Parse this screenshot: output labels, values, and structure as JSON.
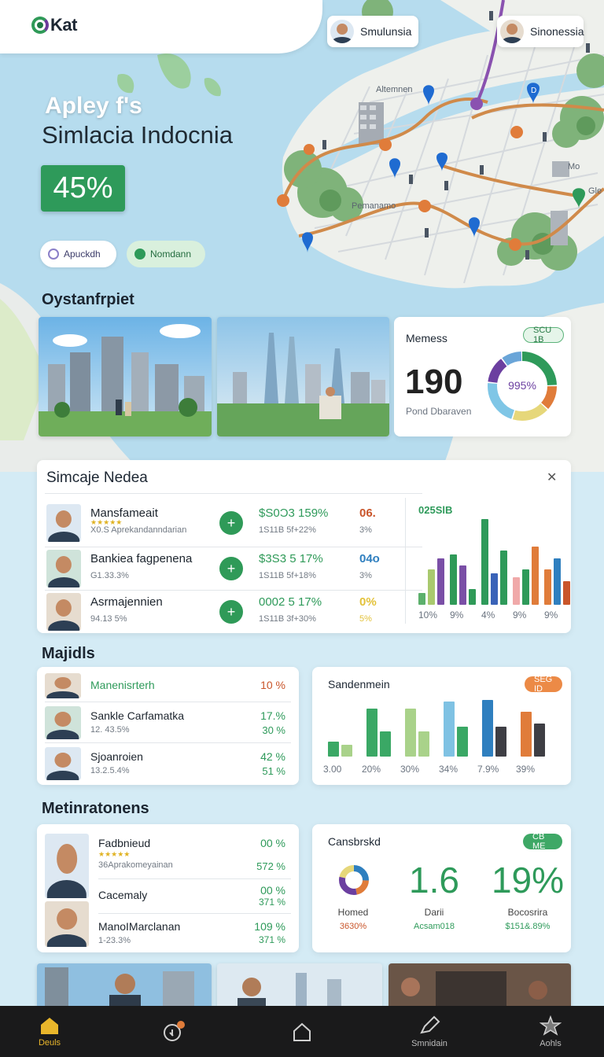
{
  "app": {
    "logo_text": "Kat"
  },
  "profiles": [
    {
      "name": "Smulunsia"
    },
    {
      "name": "Sinonessia"
    }
  ],
  "map_labels": {
    "top": "Altemnen",
    "mid": "Pemanamo",
    "right_1": "Mo",
    "right_2": "Gle",
    "pin": "D"
  },
  "hero": {
    "subtitle": "Apley f's",
    "title": "Simlacia Indocnia",
    "percent": "45%",
    "pill_1": "Apuckdh",
    "pill_2": "Nomdann"
  },
  "sections": {
    "overview": "Oystanfrpiet",
    "majidls": "Majidls",
    "metinrationens": "Metinratonens"
  },
  "metrics_card": {
    "title": "Memess",
    "badge": "SCU 1B",
    "value": "190",
    "sub": "Pond Dbaraven",
    "donut_label": "995%",
    "donut": [
      {
        "value": 25,
        "color": "#2e9a5a"
      },
      {
        "value": 12,
        "color": "#e07c3a"
      },
      {
        "value": 18,
        "color": "#e6d77a"
      },
      {
        "value": 22,
        "color": "#7fc6e6"
      },
      {
        "value": 13,
        "color": "#6b3fa0"
      },
      {
        "value": 10,
        "color": "#6aa5d8"
      }
    ]
  },
  "simcaje": {
    "title": "Simcaje Nedea",
    "close_label": "✕",
    "rows": [
      {
        "name": "Mansfameait",
        "stars": "★★★★★",
        "sub": "X0.S Aprekandanndarian",
        "val": "$S0Ɔ3 159%",
        "val2": "1S11B 5f+22%",
        "pct": "06.",
        "pct_color": "#c9552a",
        "pct2": "3%"
      },
      {
        "name": "Bankiea fagpenena",
        "stars": "",
        "sub": "G1.33.3%",
        "val": "$3S3 5 17%",
        "val2": "1S11B 5f+18%",
        "pct": "04o",
        "pct_color": "#2f7fbf",
        "pct2": "3%"
      },
      {
        "name": "Asrmajennien",
        "stars": "",
        "sub": "94.13 5%",
        "val": "0002 5 17%",
        "val2": "1S11B 3f+30%",
        "pct": "0%",
        "pct_color": "#e3c23a",
        "pct2": "5%"
      }
    ],
    "chart": {
      "label": "025SlB",
      "groups": [
        {
          "label": "10%",
          "values": [
            15,
            45,
            60
          ]
        },
        {
          "label": "9%",
          "values": [
            65,
            50,
            20
          ]
        },
        {
          "label": "4%",
          "values": [
            110,
            40,
            70
          ]
        },
        {
          "label": "9%",
          "values": [
            35,
            45,
            75
          ]
        },
        {
          "label": "9%",
          "values": [
            45,
            60,
            30
          ]
        }
      ]
    }
  },
  "chart_data": [
    {
      "type": "bar",
      "categories": [
        "10%",
        "9%",
        "4%",
        "9%",
        "9%"
      ],
      "series": [
        {
          "values": [
            15,
            65,
            110,
            35,
            45
          ]
        },
        {
          "values": [
            45,
            50,
            40,
            45,
            60
          ]
        },
        {
          "values": [
            60,
            20,
            70,
            75,
            30
          ]
        }
      ],
      "title": "025SlB",
      "xlabel": "",
      "ylabel": ""
    },
    {
      "type": "bar",
      "categories": [
        "3.00",
        "20%",
        "30%",
        "34%",
        "7.9%",
        "39%"
      ],
      "series": [
        {
          "values": [
            18,
            58,
            58,
            66,
            68,
            54
          ]
        },
        {
          "values": [
            14,
            30,
            30,
            36,
            36,
            40
          ]
        }
      ],
      "title": "Sandenmein",
      "xlabel": "",
      "ylabel": ""
    }
  ],
  "majidls": {
    "rows": [
      {
        "name": "Manenisrterh",
        "sub": "",
        "pct": "10 %",
        "pct_color": "#c9552a",
        "pct2": ""
      },
      {
        "name": "Sankle Carfamatka",
        "sub": "12. 43.5%",
        "pct": "17.%",
        "pct_color": "#2e9a5a",
        "pct2": "30 %"
      },
      {
        "name": "Sjoanroien",
        "sub": "13.2.5.4%",
        "pct": "42 %",
        "pct_color": "#2e9a5a",
        "pct2": "51 %"
      }
    ]
  },
  "sandenmein": {
    "title": "Sandenmein",
    "badge": "SEG ID",
    "labels": [
      "3.00",
      "20%",
      "30%",
      "34%",
      "7.9%",
      "39%"
    ]
  },
  "metinrationens": {
    "rows": [
      {
        "name": "Fadbnieud",
        "stars": "★★★★★",
        "sub": "36Aprakomeyainan",
        "pct": "00 %",
        "pct2": "572 %"
      },
      {
        "name": "Cacemaly",
        "stars": "",
        "sub": "",
        "pct": "00 %",
        "pct2": "371 %"
      },
      {
        "name": "ManoIMarclanan",
        "stars": "",
        "sub": "1-23.3%",
        "pct": "109 %",
        "pct2": "371 %"
      }
    ]
  },
  "cansbrskd": {
    "title": "Cansbrskd",
    "badge": "CB ME",
    "stats": [
      {
        "label": "Homed",
        "sub": "3630%",
        "sub_color": "#c9552a"
      },
      {
        "value": "1.6",
        "label": "Darii",
        "sub": "Acsam018",
        "sub_color": "#2e9a5a"
      },
      {
        "value": "19%",
        "label": "Bocosrira",
        "sub": "$151&.89%",
        "sub_color": "#2e9a5a"
      }
    ]
  },
  "nav": {
    "items": [
      {
        "label": "Deuls",
        "icon": "home-icon",
        "active": true
      },
      {
        "label": "",
        "icon": "search-chat-icon",
        "active": false
      },
      {
        "label": "",
        "icon": "house-outline-icon",
        "active": false
      },
      {
        "label": "Smnidain",
        "icon": "pen-icon",
        "active": false
      },
      {
        "label": "Aohls",
        "icon": "star-icon",
        "active": false
      }
    ]
  }
}
